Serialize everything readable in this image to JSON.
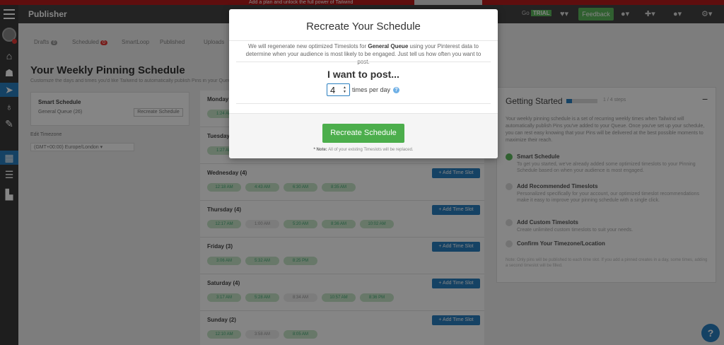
{
  "app": {
    "title": "Publisher",
    "plan_badge": "Go",
    "plan_badge_pill": "TRIAL",
    "feedback_label": "Feedback",
    "promo_text": "Add a plan and unlock the full power of Tailwind"
  },
  "tabs": [
    {
      "label": "Drafts",
      "count": "0"
    },
    {
      "label": "Scheduled",
      "count": "0"
    },
    {
      "label": "SmartLoop",
      "count": ""
    },
    {
      "label": "Published",
      "count": ""
    },
    {
      "label": "Uploads",
      "count": ""
    }
  ],
  "page": {
    "title": "Your Weekly Pinning Schedule",
    "subtitle": "Customize the days and times you'd like Tailwind to automatically publish Pins in your Queue."
  },
  "smart_schedule": {
    "title": "Smart Schedule",
    "queue": "General Queue (26)",
    "button": "Recreate Schedule"
  },
  "timezone": {
    "label": "Edit Timezone",
    "value": "(GMT+00:00) Europe/London"
  },
  "days": [
    {
      "name": "Monday",
      "add_label": "+ Add Time Slot",
      "slots": [
        "1:24 AM"
      ]
    },
    {
      "name": "Tuesday",
      "add_label": "+ Add Time Slot",
      "slots": [
        "1:27 AM"
      ]
    },
    {
      "name": "Wednesday (4)",
      "add_label": "+ Add Time Slot",
      "slots": [
        "12:18 AM",
        "4:43 AM",
        "6:30 AM",
        "8:35 AM"
      ]
    },
    {
      "name": "Thursday (4)",
      "add_label": "+ Add Time Slot",
      "slots": [
        "12:17 AM",
        "1:00 AM",
        "5:20 AM",
        "8:36 AM",
        "10:02 AM"
      ]
    },
    {
      "name": "Friday (3)",
      "add_label": "+ Add Time Slot",
      "slots": [
        "3:06 AM",
        "5:32 AM",
        "8:25 PM"
      ]
    },
    {
      "name": "Saturday (4)",
      "add_label": "+ Add Time Slot",
      "slots": [
        "3:17 AM",
        "5:28 AM",
        "8:34 AM",
        "10:57 AM",
        "8:36 PM"
      ]
    },
    {
      "name": "Sunday (2)",
      "add_label": "+ Add Time Slot",
      "slots": [
        "12:10 AM",
        "3:58 AM",
        "8:05 AM"
      ]
    }
  ],
  "getting_started": {
    "title": "Getting Started",
    "steps": "1 / 4 steps",
    "intro": "Your weekly pinning schedule is a set of recurring weekly times when Tailwind will automatically publish Pins you've added to your Queue. Once you've set up your schedule, you can rest easy knowing that your Pins will be delivered at the best possible moments to maximize their reach.",
    "items": [
      {
        "title": "Smart Schedule",
        "desc": "To get you started, we've already added some optimized timeslots to your Pinning Schedule based on when your audience is most engaged.",
        "done": true
      },
      {
        "title": "Add Recommended Timeslots",
        "desc": "Personalized specifically for your account, our optimized timeslot recommendations make it easy to improve your pinning schedule with a single click.",
        "done": false
      },
      {
        "title": "Add Custom Timeslots",
        "desc": "Create unlimited custom timeslots to suit your needs.",
        "done": false
      },
      {
        "title": "Confirm Your Timezone/Location",
        "desc": "",
        "done": false
      }
    ],
    "note": "Note: Only pins will be published to each time slot. If you add a pinned creates in a day, some times, adding a second timeslot will be filled."
  },
  "modal": {
    "title": "Recreate Your Schedule",
    "desc_prefix": "We will regenerate new optimized Timeslots for",
    "desc_queue": "General Queue",
    "desc_suffix": "using your Pinterest data to determine when your audience is most likely to be engaged. Just tell us how often you want to post.",
    "heading": "I want to post...",
    "posts_per_day": "4",
    "unit_label": "times per day",
    "help_glyph": "?",
    "button_label": "Recreate Schedule",
    "note_bold": "* Note:",
    "note_text": "All of your existing Timeslots will be replaced."
  },
  "colors": {
    "accent_blue": "#2a7fc0",
    "success_green": "#4cae4c",
    "brand_red": "#b71c1c"
  },
  "icons": {
    "help": "?",
    "nav": [
      "home",
      "users",
      "publisher",
      "bulb",
      "calendar",
      "chart"
    ]
  }
}
